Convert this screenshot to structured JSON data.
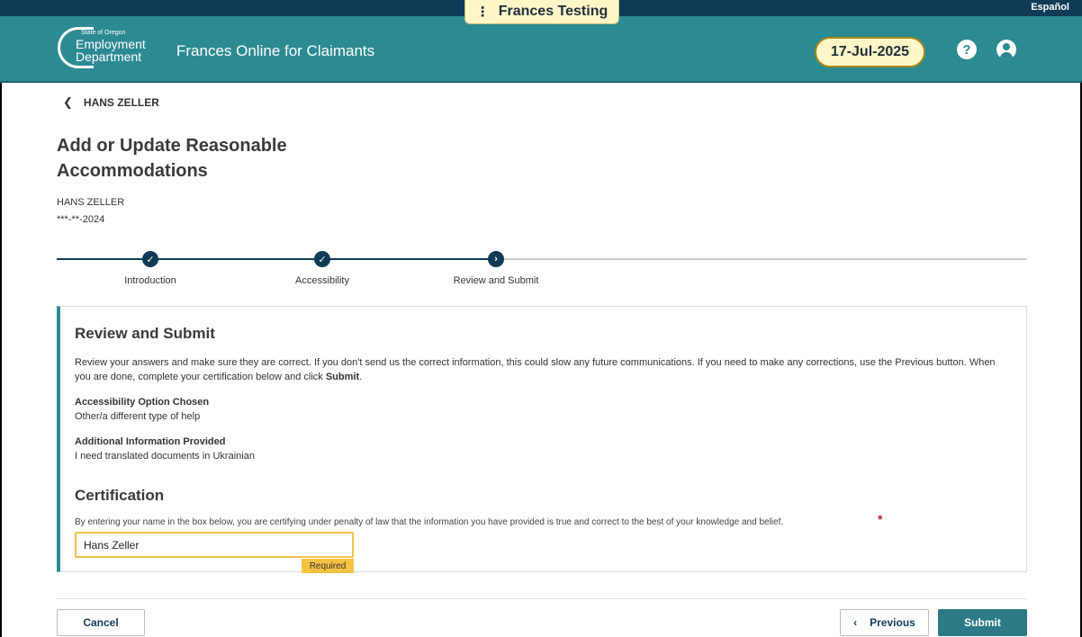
{
  "utility": {
    "language_link": "Español"
  },
  "environment": {
    "label": "Frances Testing"
  },
  "header": {
    "logo_small": "State of Oregon",
    "logo_line1": "Employment",
    "logo_line2": "Department",
    "app_title": "Frances Online for Claimants",
    "date": "17-Jul-2025",
    "help_icon": "question-circle-icon",
    "user_icon": "user-circle-icon"
  },
  "breadcrumb": {
    "back_label": "HANS ZELLER"
  },
  "page": {
    "title": "Add or Update Reasonable Accommodations",
    "claimant_name": "HANS ZELLER",
    "claimant_ssn": "***-**-2024"
  },
  "stepper": {
    "steps": [
      {
        "label": "Introduction",
        "status": "complete"
      },
      {
        "label": "Accessibility",
        "status": "complete"
      },
      {
        "label": "Review and Submit",
        "status": "current"
      }
    ]
  },
  "review": {
    "title": "Review and Submit",
    "instructions_pre": "Review your answers and make sure they are correct. If you don't send us the correct information, this could slow any future communications. If you need to make any corrections, use the Previous button. When you are done, complete your certification below and click ",
    "instructions_bold": "Submit",
    "instructions_post": ".",
    "accessibility_label": "Accessibility Option Chosen",
    "accessibility_value": "Other/a different type of help",
    "additional_label": "Additional Information Provided",
    "additional_value": "I need translated documents in Ukrainian"
  },
  "certification": {
    "title": "Certification",
    "text": "By entering your name in the box below, you are certifying under penalty of law that the information you have provided is true and correct to the best of your knowledge and belief.",
    "required_star": "*",
    "input_value": "Hans Zeller",
    "required_tag": "Required"
  },
  "footer": {
    "cancel_label": "Cancel",
    "previous_label": "Previous",
    "submit_label": "Submit"
  },
  "colors": {
    "header_teal": "#2c8a93",
    "navy": "#0f3b57",
    "badge_yellow": "#fff6c8",
    "required_yellow": "#f5c342",
    "submit_teal": "#2c7a86"
  }
}
